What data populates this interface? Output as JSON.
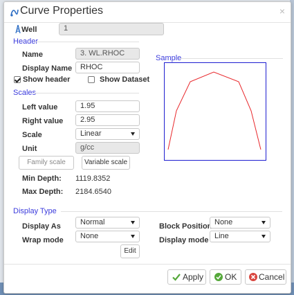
{
  "dialog": {
    "title": "Curve Properties",
    "close_glyph": "×",
    "title_icon": "curve-icon"
  },
  "well": {
    "label": "Well",
    "value": "1",
    "icon": "well-icon"
  },
  "header": {
    "section_title": "Header",
    "name_label": "Name",
    "name_value": "3. WL.RHOC",
    "display_name_label": "Display Name",
    "display_name_value": "RHOC",
    "show_header_label": "Show header",
    "show_header_checked": true,
    "show_dataset_label": "Show Dataset",
    "show_dataset_checked": false
  },
  "sample": {
    "title": "Sample",
    "border_color": "#1c1cd0",
    "curve_color": "#e8262a"
  },
  "scales": {
    "section_title": "Scales",
    "left_value_label": "Left value",
    "left_value": "1.95",
    "right_value_label": "Right value",
    "right_value": "2.95",
    "scale_label": "Scale",
    "scale_value": "Linear",
    "unit_label": "Unit",
    "unit_value": "g/cc",
    "family_scale_button": "Family scale",
    "variable_scale_button": "Variable scale",
    "min_depth_label": "Min Depth:",
    "min_depth_value": "1119.8352",
    "max_depth_label": "Max Depth:",
    "max_depth_value": "2184.6540"
  },
  "display_type": {
    "section_title": "Display Type",
    "display_as_label": "Display As",
    "display_as_value": "Normal",
    "wrap_mode_label": "Wrap mode",
    "wrap_mode_value": "None",
    "block_position_label": "Block Position",
    "block_position_value": "None",
    "display_mode_label": "Display mode",
    "display_mode_value": "Line",
    "edit_button": "Edit"
  },
  "footer": {
    "apply_label": "Apply",
    "ok_label": "OK",
    "cancel_label": "Cancel",
    "apply_icon_color": "#55a83a",
    "ok_icon_color": "#55a83a",
    "cancel_icon_color": "#d9463f"
  }
}
